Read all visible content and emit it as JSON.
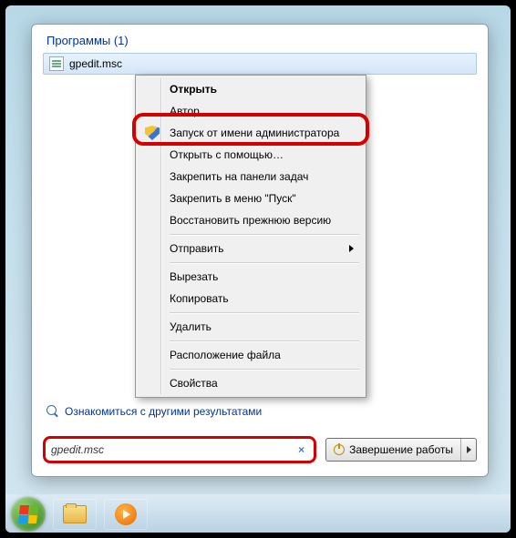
{
  "panel": {
    "section_label": "Программы (1)",
    "result_name": "gpedit.msc",
    "more_results": "Ознакомиться с другими результатами",
    "search_value": "gpedit.msc",
    "shutdown_label": "Завершение работы"
  },
  "ctx": {
    "open": "Открыть",
    "author": "Автор",
    "run_as_admin": "Запуск от имени администратора",
    "open_with": "Открыть с помощью…",
    "pin_taskbar": "Закрепить на панели задач",
    "pin_start": "Закрепить в меню \"Пуск\"",
    "restore": "Восстановить прежнюю версию",
    "send_to": "Отправить",
    "cut": "Вырезать",
    "copy": "Копировать",
    "delete": "Удалить",
    "location": "Расположение файла",
    "properties": "Свойства"
  }
}
